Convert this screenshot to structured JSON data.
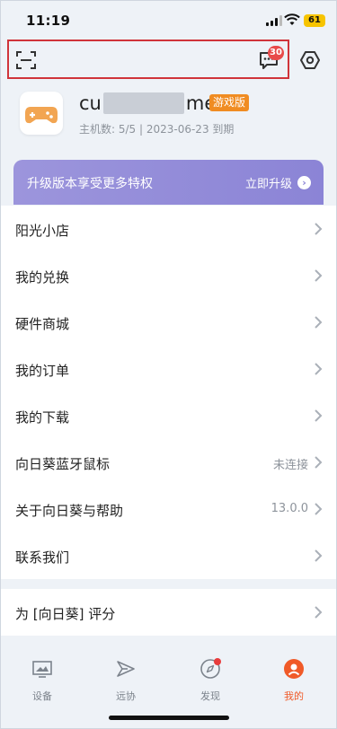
{
  "status_bar": {
    "time": "11:19",
    "battery": "61"
  },
  "header": {
    "message_badge": "30"
  },
  "profile": {
    "name_prefix": "cu",
    "name_suffix": "me",
    "edition": "游戏版",
    "host_info": "主机数: 5/5 | 2023-06-23 到期"
  },
  "banner": {
    "title": "升级版本享受更多特权",
    "cta": "立即升级"
  },
  "menu": [
    {
      "label": "阳光小店",
      "value": ""
    },
    {
      "label": "我的兑换",
      "value": ""
    },
    {
      "label": "硬件商城",
      "value": ""
    },
    {
      "label": "我的订单",
      "value": ""
    },
    {
      "label": "我的下载",
      "value": ""
    },
    {
      "label": "向日葵蓝牙鼠标",
      "value": "未连接"
    },
    {
      "label": "关于向日葵与帮助",
      "value": "13.0.0"
    },
    {
      "label": "联系我们",
      "value": ""
    }
  ],
  "rate": {
    "label": "为 [向日葵] 评分"
  },
  "tabs": [
    {
      "label": "设备",
      "icon": "device-icon"
    },
    {
      "label": "远协",
      "icon": "remote-assist-icon"
    },
    {
      "label": "发现",
      "icon": "compass-icon"
    },
    {
      "label": "我的",
      "icon": "profile-icon"
    }
  ],
  "colors": {
    "accent": "#f05a28",
    "banner": "#8b84d6",
    "badge": "#e84a4a",
    "edition": "#f08c22"
  }
}
